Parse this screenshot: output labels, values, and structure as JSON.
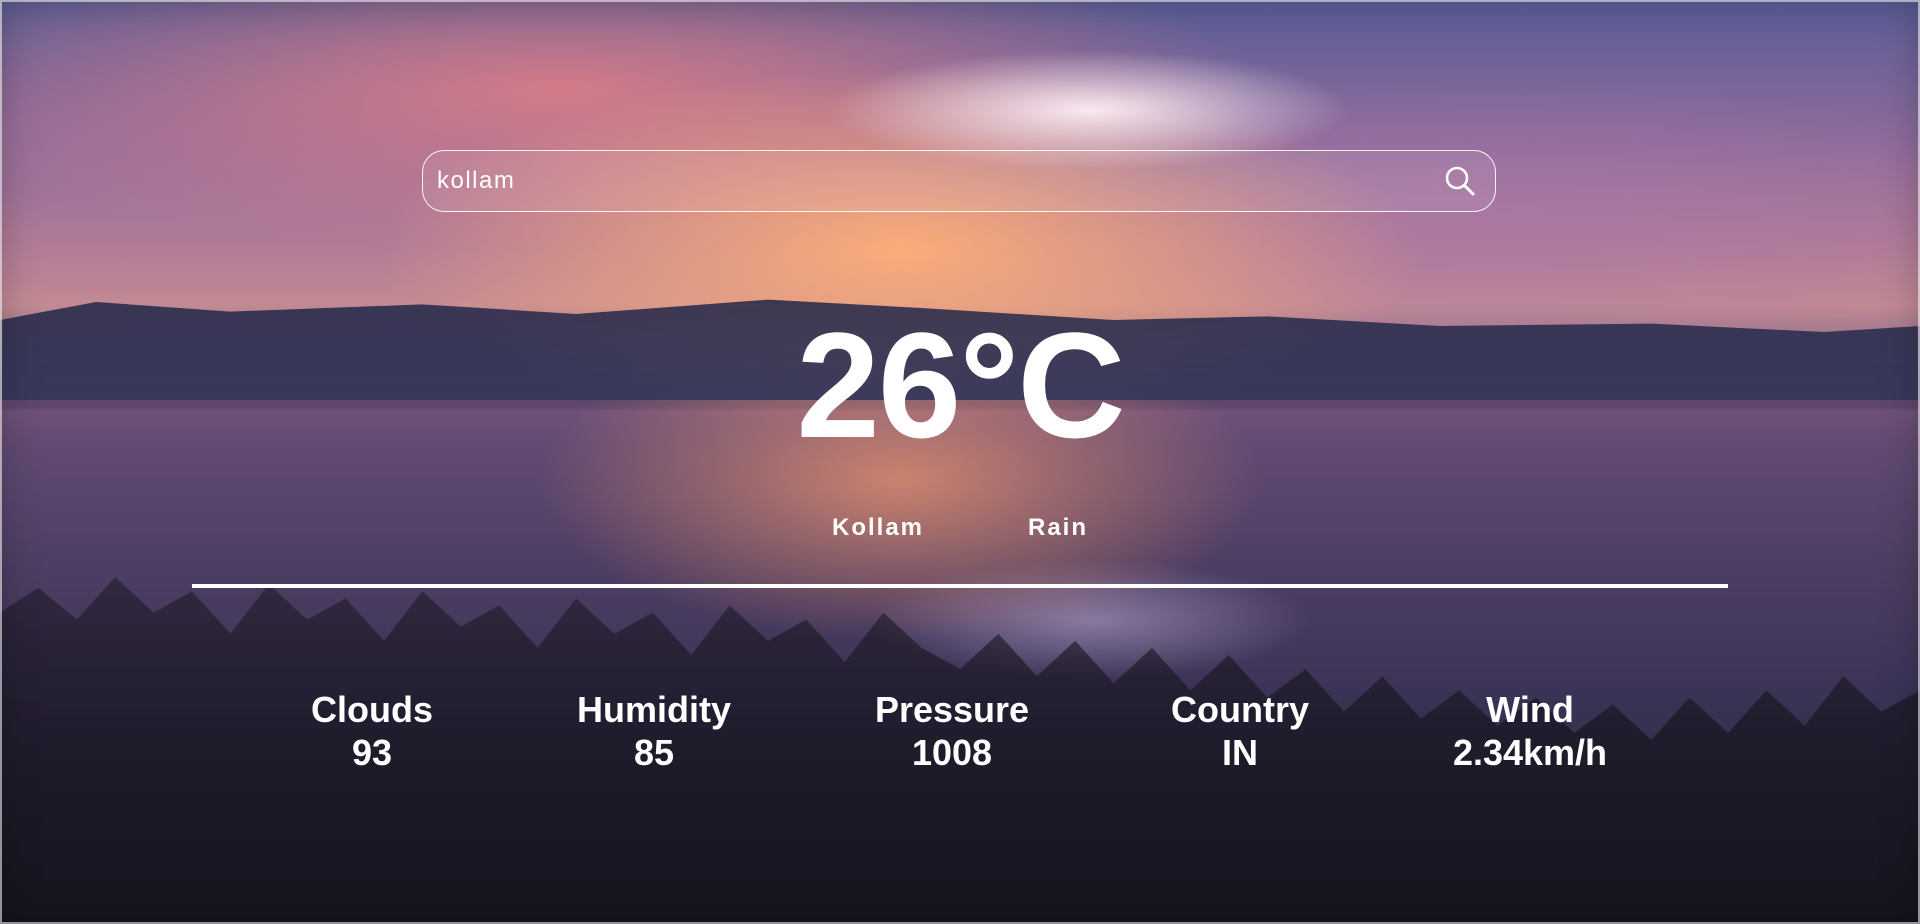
{
  "search": {
    "value": "kollam",
    "icon": "search-icon"
  },
  "weather": {
    "temperature": "26°C",
    "city": "Kollam",
    "condition": "Rain"
  },
  "stats": [
    {
      "label": "Clouds",
      "value": "93"
    },
    {
      "label": "Humidity",
      "value": "85"
    },
    {
      "label": "Pressure",
      "value": "1008"
    },
    {
      "label": "Country",
      "value": "IN"
    },
    {
      "label": "Wind",
      "value": "2.34km/h"
    }
  ],
  "colors": {
    "text": "#ffffff",
    "divider": "#ffffff"
  }
}
